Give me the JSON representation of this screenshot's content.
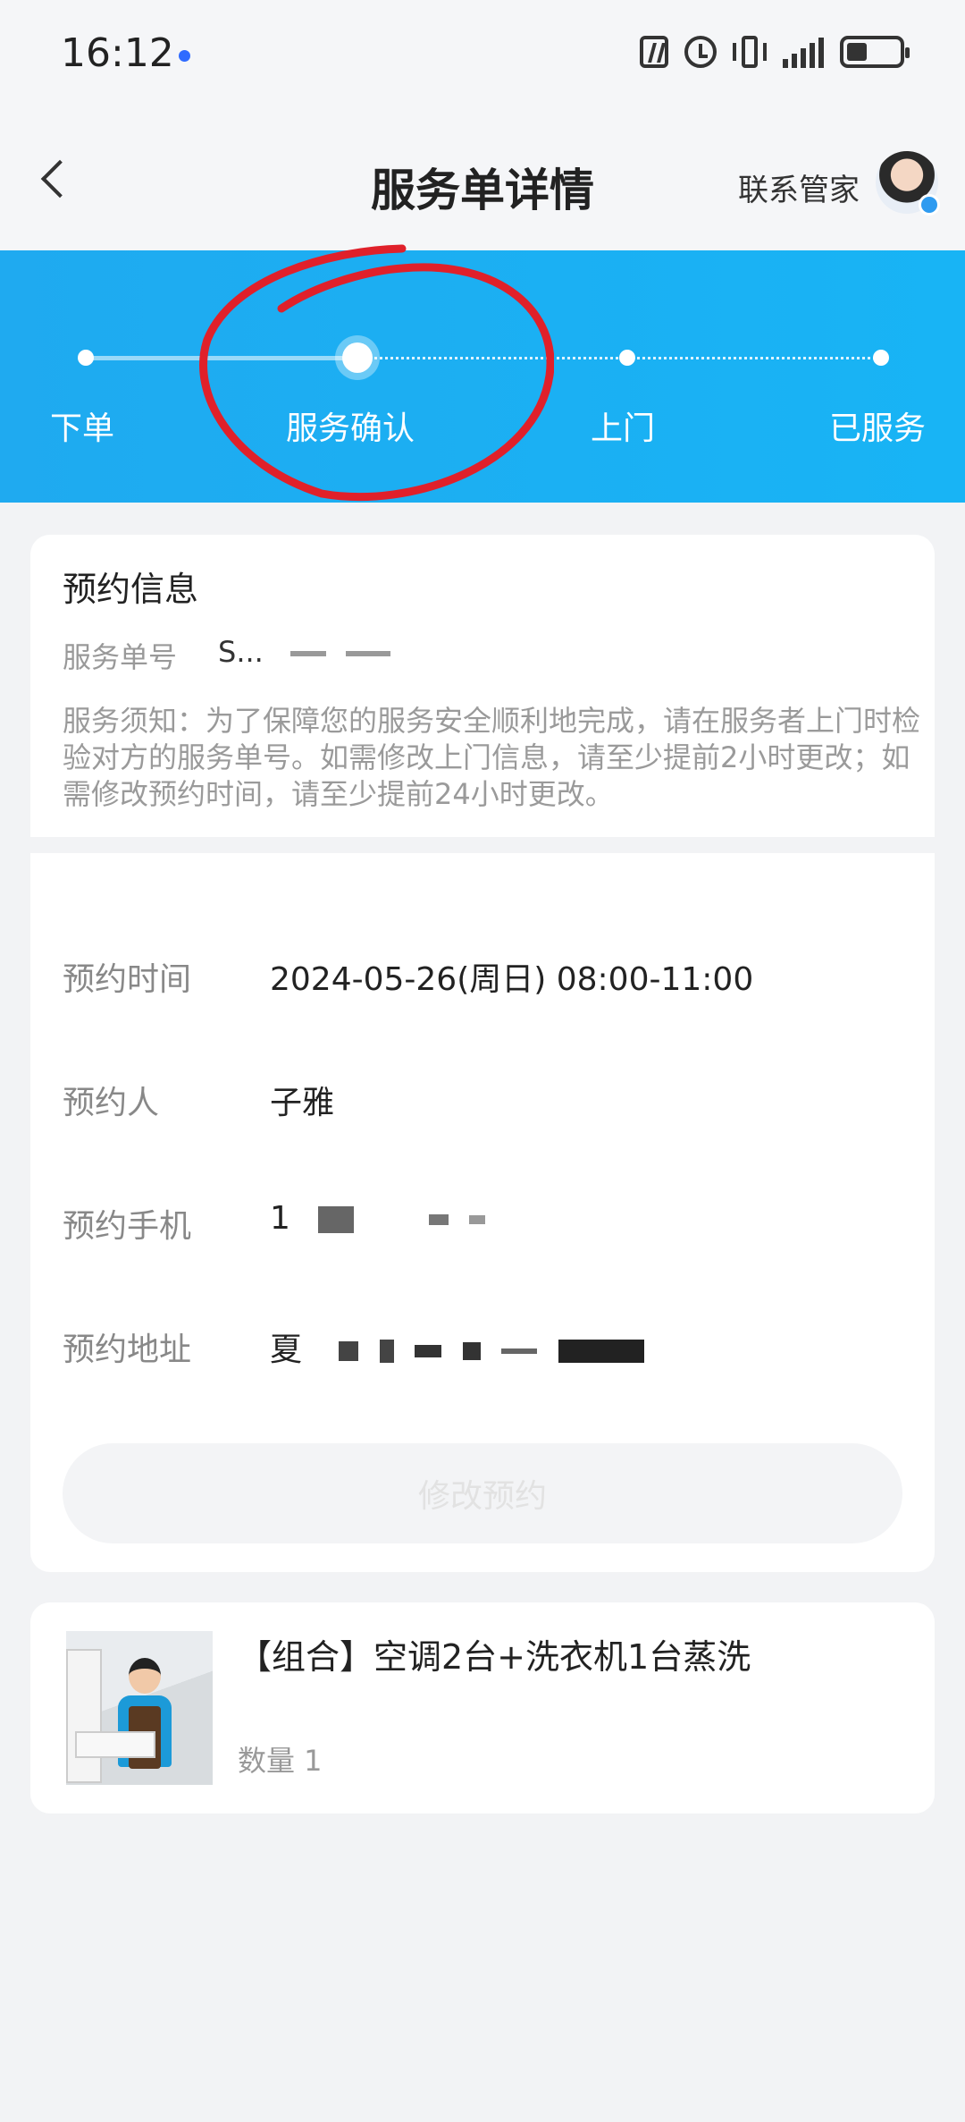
{
  "status_bar": {
    "time": "16:12"
  },
  "header": {
    "title": "服务单详情",
    "contact_label": "联系管家"
  },
  "progress": {
    "steps": [
      {
        "label": "下单"
      },
      {
        "label": "服务确认"
      },
      {
        "label": "上门"
      },
      {
        "label": "已服务"
      }
    ],
    "current_step_index": 1
  },
  "appointment_info": {
    "title": "预约信息",
    "order_label": "服务单号",
    "order_value": "S...",
    "notice": "服务须知：为了保障您的服务安全顺利地完成，请在服务者上门时检验对方的服务单号。如需修改上门信息，请至少提前2小时更改；如需修改预约时间，请至少提前24小时更改。",
    "rows": [
      {
        "label": "预约时间",
        "value": "2024-05-26(周日) 08:00-11:00"
      },
      {
        "label": "预约人",
        "value": "子雅"
      },
      {
        "label": "预约手机",
        "value": "1"
      },
      {
        "label": "预约地址",
        "value": "夏"
      }
    ],
    "modify_button": "修改预约"
  },
  "product": {
    "title": "【组合】空调2台+洗衣机1台蒸洗",
    "quantity_label": "数量 1"
  },
  "colors": {
    "banner": "#1faaf0",
    "annotation": "#e0202a"
  }
}
